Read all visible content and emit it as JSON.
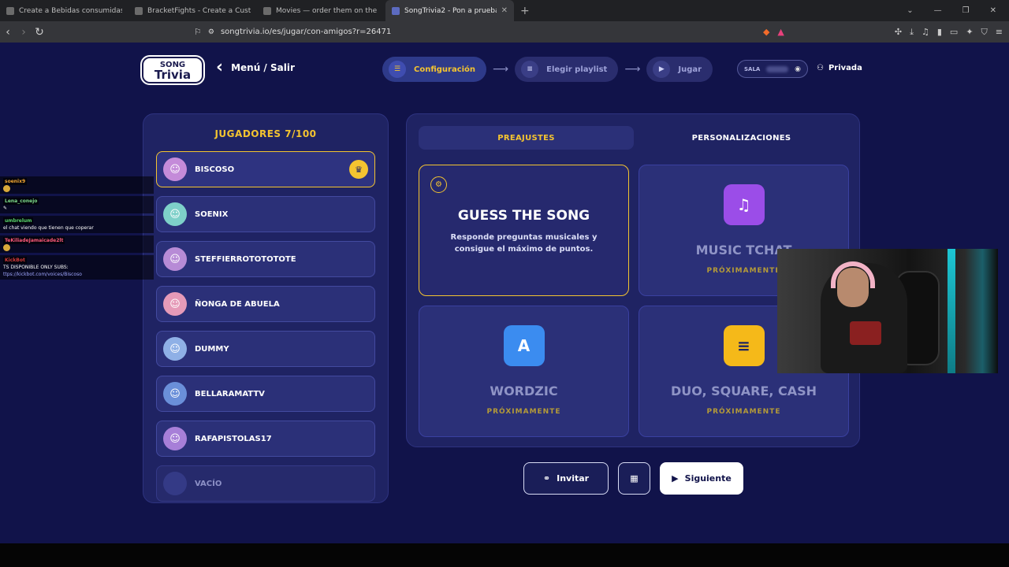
{
  "browser": {
    "tabs": [
      {
        "title": "Create a Bebidas consumidas en Me",
        "active": false
      },
      {
        "title": "BracketFights - Create a Custom Tou",
        "active": false
      },
      {
        "title": "Movies — order them on the timelin",
        "active": false
      },
      {
        "title": "SongTrivia2 - Pon a prueba tus c",
        "active": true
      }
    ],
    "new_tab": "+",
    "url": "songtrivia.io/es/jugar/con-amigos?r=26471"
  },
  "app": {
    "logo_line1": "SONG",
    "logo_line2": "Trivia",
    "back_label": "Menú / Salir",
    "steps": [
      {
        "label": "Configuración",
        "icon": "sliders-icon",
        "active": true
      },
      {
        "label": "Elegir playlist",
        "icon": "playlist-icon",
        "active": false
      },
      {
        "label": "Jugar",
        "icon": "play-icon",
        "active": false
      }
    ],
    "sala_label": "SALA",
    "privacy_label": "Privada"
  },
  "players": {
    "title": "JUGADORES 7/100",
    "list": [
      {
        "name": "BISCOSO",
        "host": true,
        "color": "#c48bd9"
      },
      {
        "name": "SOENIX",
        "host": false,
        "color": "#7ed0c9"
      },
      {
        "name": "STEFFIERROTOTOTOTE",
        "host": false,
        "color": "#b78bd6"
      },
      {
        "name": "ÑONGA DE ABUELA",
        "host": false,
        "color": "#e59ab8"
      },
      {
        "name": "DUMMY",
        "host": false,
        "color": "#8fb0e6"
      },
      {
        "name": "BELLARAMATTV",
        "host": false,
        "color": "#6a8fd9"
      },
      {
        "name": "RAFAPISTOLAS17",
        "host": false,
        "color": "#a77fd8"
      },
      {
        "name": "VACÍO",
        "host": false,
        "empty": true,
        "color": "#343a86"
      }
    ]
  },
  "settings": {
    "tabs": [
      "PREAJUSTES",
      "PERSONALIZACIONES"
    ],
    "cards": {
      "guess": {
        "title": "GUESS THE SONG",
        "desc": "Responde preguntas musicales y consigue el máximo de puntos."
      },
      "music_tchat": {
        "title": "MUSIC TCHAT",
        "soon": "PRÓXIMAMENTE",
        "color": "#9b4de8"
      },
      "wordzic": {
        "title": "WORDZIC",
        "soon": "PRÓXIMAMENTE",
        "color": "#3b8cf0"
      },
      "duo": {
        "title": "DUO, SQUARE, CASH",
        "soon": "PRÓXIMAMENTE",
        "color": "#f5b919"
      }
    }
  },
  "actions": {
    "invite": "Invitar",
    "next": "Siguiente"
  },
  "chat": [
    {
      "user": "soenix9",
      "user_color": "#f4a732",
      "text": ""
    },
    {
      "user": "Lena_conejo",
      "user_color": "#7ddc8a",
      "text": ""
    },
    {
      "user": "umbrelum",
      "user_color": "#58d46b",
      "text": "el chat viendo que tienen que coperar"
    },
    {
      "user": "TeKiliadeJamaicade2lt",
      "user_color": "#ff5a7a",
      "text": ""
    },
    {
      "user": "KickBot",
      "user_color": "#d43a3a",
      "text": "TS DISPONIBLE ONLY SUBS:",
      "link": "ttps://kickbot.com/voices/Biscoso"
    }
  ]
}
